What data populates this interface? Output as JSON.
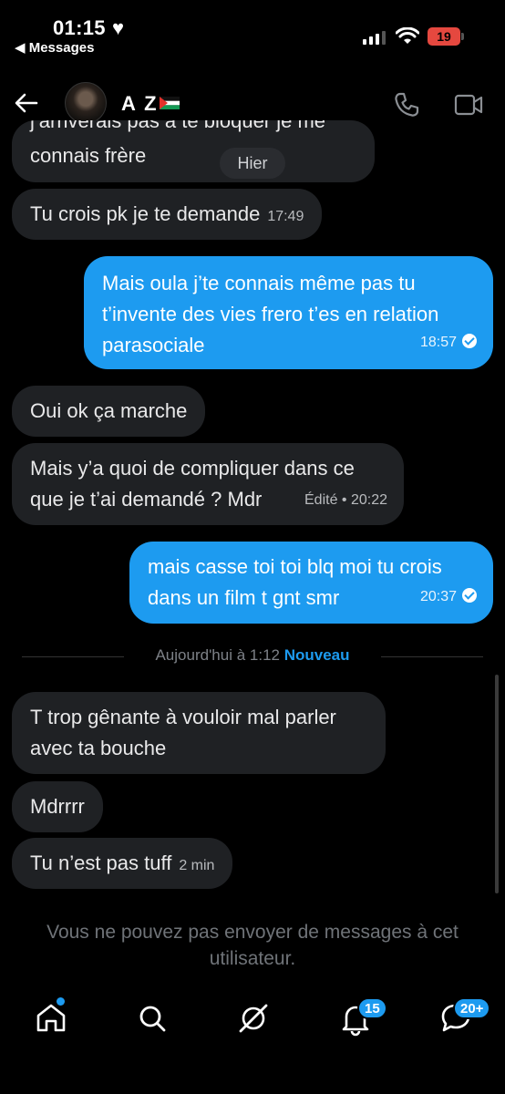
{
  "status_bar": {
    "time": "01:15",
    "heart": "♥",
    "back_app": "◀ Messages",
    "battery": "19"
  },
  "header": {
    "name": "A Z",
    "icons": [
      "back-arrow-icon",
      "phone-icon",
      "video-call-icon",
      "palestine-flag-icon"
    ]
  },
  "messages": [
    {
      "id": "m0",
      "dir": "in",
      "partial_text": "j’arriverais pas à te bloquer je me",
      "text": "connais frère",
      "chip": "Hier"
    },
    {
      "id": "m1",
      "dir": "in",
      "text": "Tu crois pk je te demande",
      "time": "17:49"
    },
    {
      "id": "m2",
      "dir": "out",
      "text": "Mais oula j’te connais même pas tu t’invente des vies frero t’es en relation parasociale",
      "time": "18:57",
      "read": true
    },
    {
      "id": "m3",
      "dir": "in",
      "text": "Oui ok ça marche"
    },
    {
      "id": "m4",
      "dir": "in",
      "text": "Mais y’a quoi de compliquer dans ce que je t’ai demandé ? Mdr",
      "time": "Édité • 20:22"
    },
    {
      "id": "m5",
      "dir": "out",
      "text": "mais casse toi toi blq moi tu crois dans un film t gnt smr",
      "time": "20:37",
      "read": true
    },
    {
      "id": "m6",
      "dir": "in",
      "text": "T trop gênante à vouloir mal parler avec ta bouche"
    },
    {
      "id": "m7",
      "dir": "in",
      "text": "Mdrrrr"
    },
    {
      "id": "m8",
      "dir": "in",
      "text": "Tu n’est pas tuff",
      "time": "2 min"
    }
  ],
  "divider": {
    "label": "Aujourd'hui à 1:12",
    "new_label": "Nouveau"
  },
  "notice": "Vous ne pouvez pas envoyer de messages à cet utilisateur.",
  "tab_bar": {
    "items": [
      "home-icon",
      "search-icon",
      "grok-icon",
      "notifications-icon",
      "messages-icon"
    ],
    "notifications_badge": "15",
    "messages_badge": "20+"
  },
  "colors": {
    "accent": "#1d9bf0",
    "incoming_bubble": "#1f2124",
    "background": "#000000"
  }
}
